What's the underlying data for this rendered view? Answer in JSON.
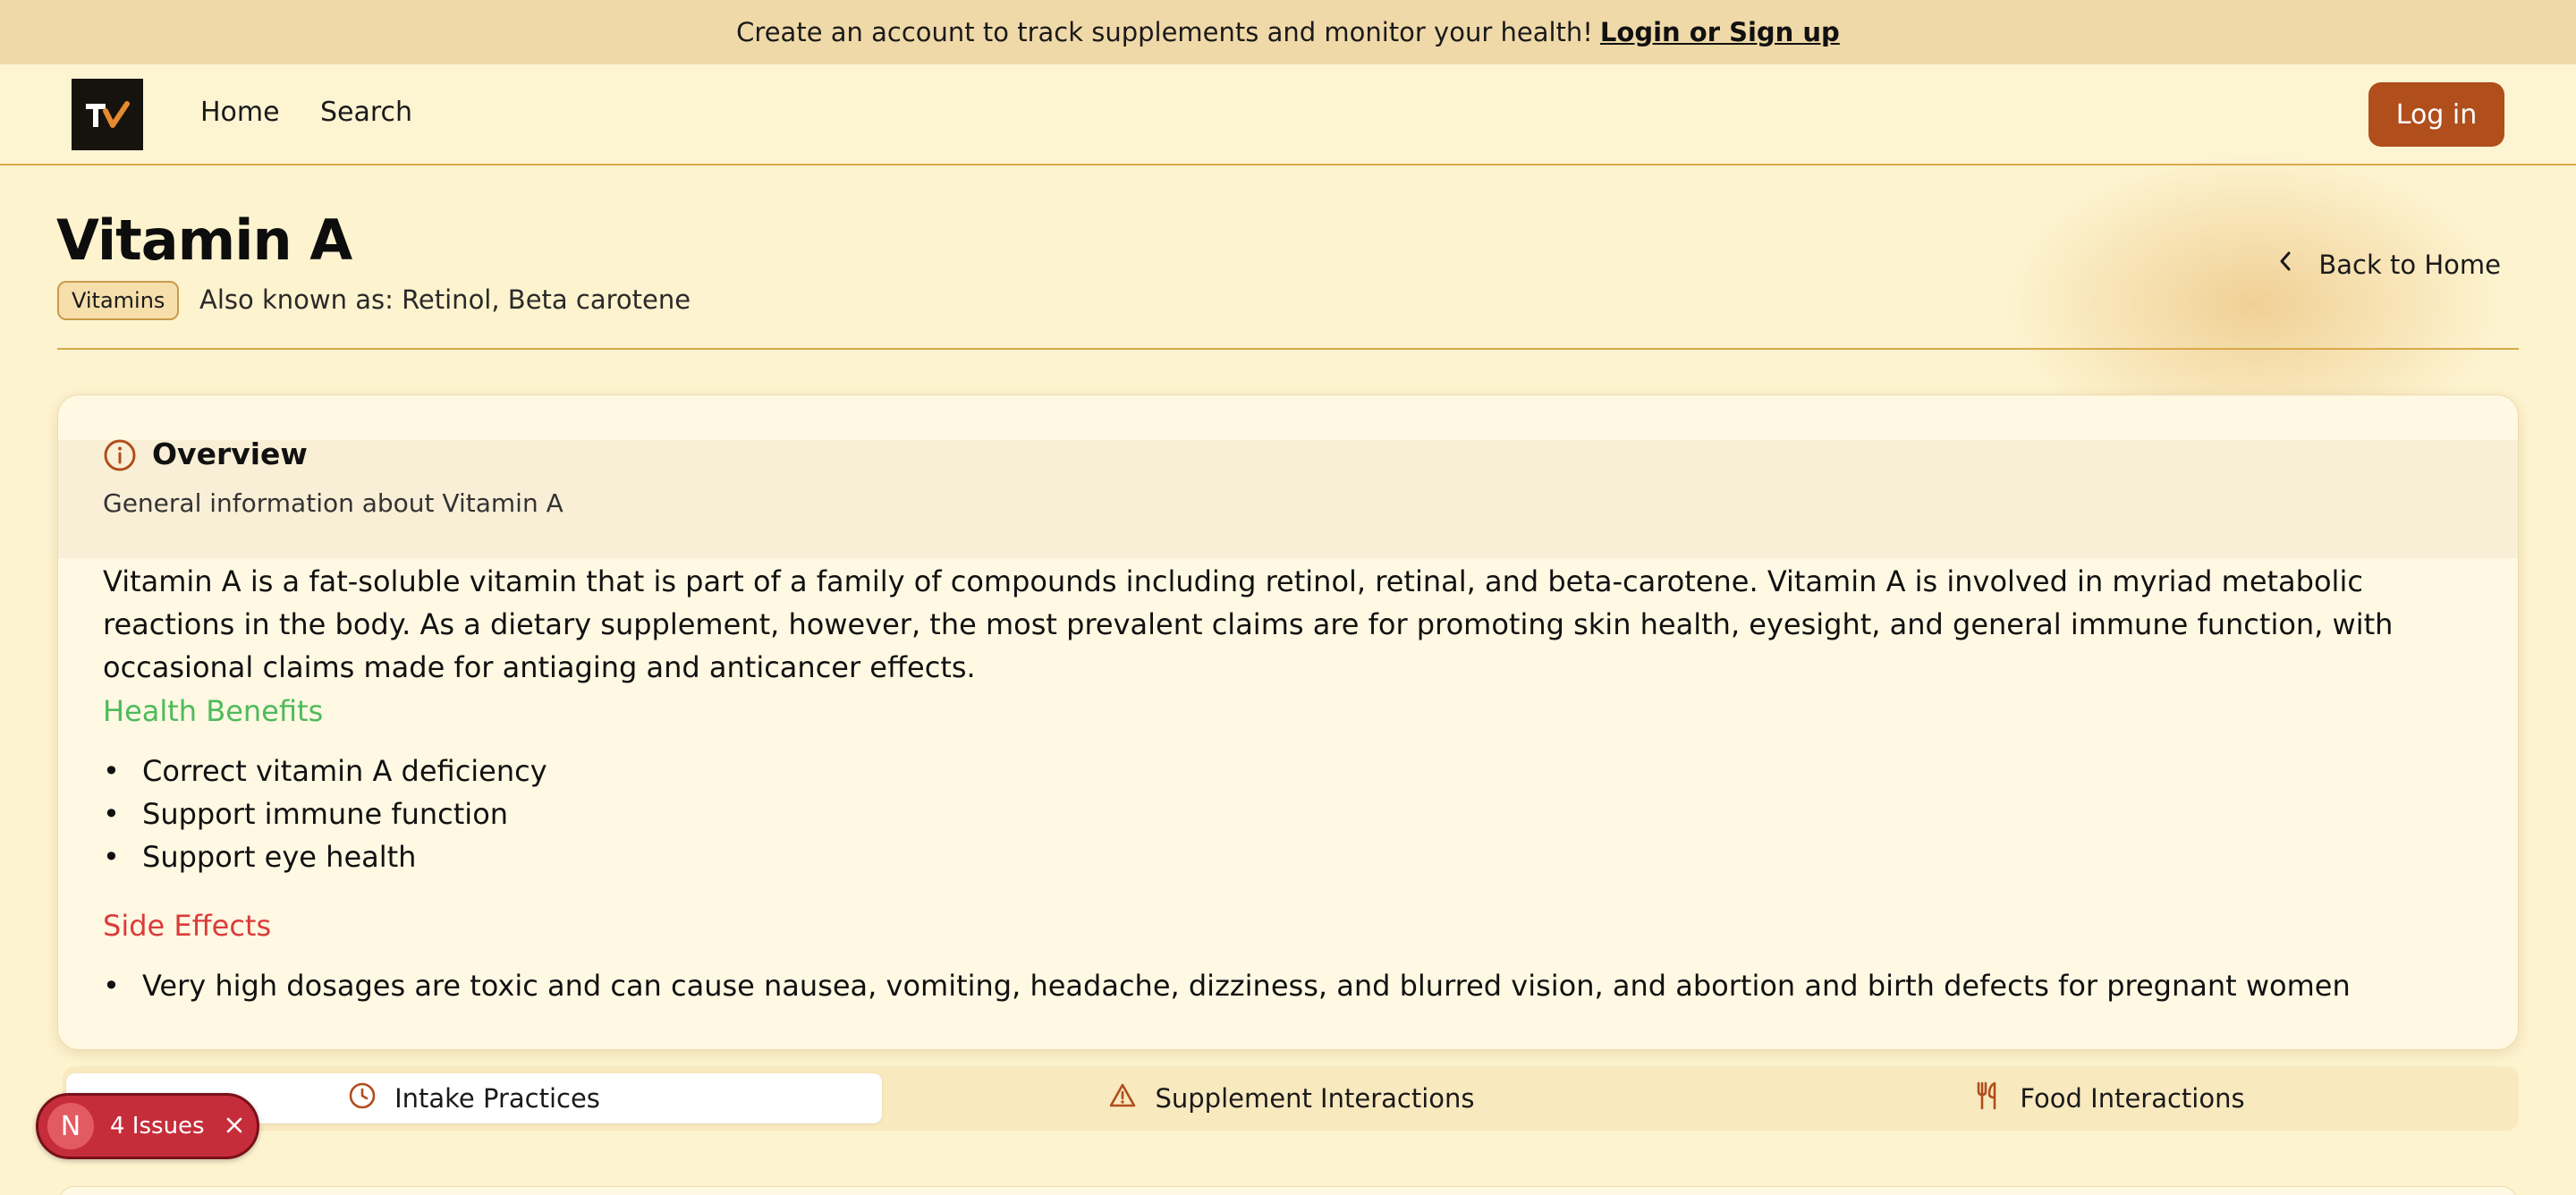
{
  "banner": {
    "text": "Create an account to track supplements and monitor your health!",
    "link": "Login or Sign up"
  },
  "nav": {
    "logo_text": "TV",
    "home": "Home",
    "search": "Search",
    "login": "Log in"
  },
  "page": {
    "title": "Vitamin A",
    "category": "Vitamins",
    "aka": "Also known as: Retinol, Beta carotene",
    "back": "Back to Home"
  },
  "overview": {
    "title": "Overview",
    "subtitle": "General information about Vitamin A",
    "text": "Vitamin A is a fat-soluble vitamin that is part of a family of compounds including retinol, retinal, and beta-carotene. Vitamin A is involved in myriad metabolic reactions in the body. As a dietary supplement, however, the most prevalent claims are for promoting skin health, eyesight, and general immune function, with occasional claims made for antiaging and anticancer effects.",
    "benefits_title": "Health Benefits",
    "benefits": [
      "Correct vitamin A deficiency",
      "Support immune function",
      "Support eye health"
    ],
    "side_effects_title": "Side Effects",
    "side_effects": [
      "Very high dosages are toxic and can cause nausea, vomiting, headache, dizziness, and blurred vision, and abortion and birth defects for pregnant women"
    ]
  },
  "tabs": [
    {
      "label": "Intake Practices",
      "icon": "clock-icon",
      "active": true
    },
    {
      "label": "Supplement Interactions",
      "icon": "warning-icon",
      "active": false
    },
    {
      "label": "Food Interactions",
      "icon": "utensils-icon",
      "active": false
    }
  ],
  "issues": {
    "badge": "N",
    "label": "4 Issues"
  },
  "colors": {
    "accent": "#b04e1c",
    "benefits": "#4cbb5a",
    "side_effects": "#db3b3b",
    "issues_bg": "#c62d3a"
  }
}
